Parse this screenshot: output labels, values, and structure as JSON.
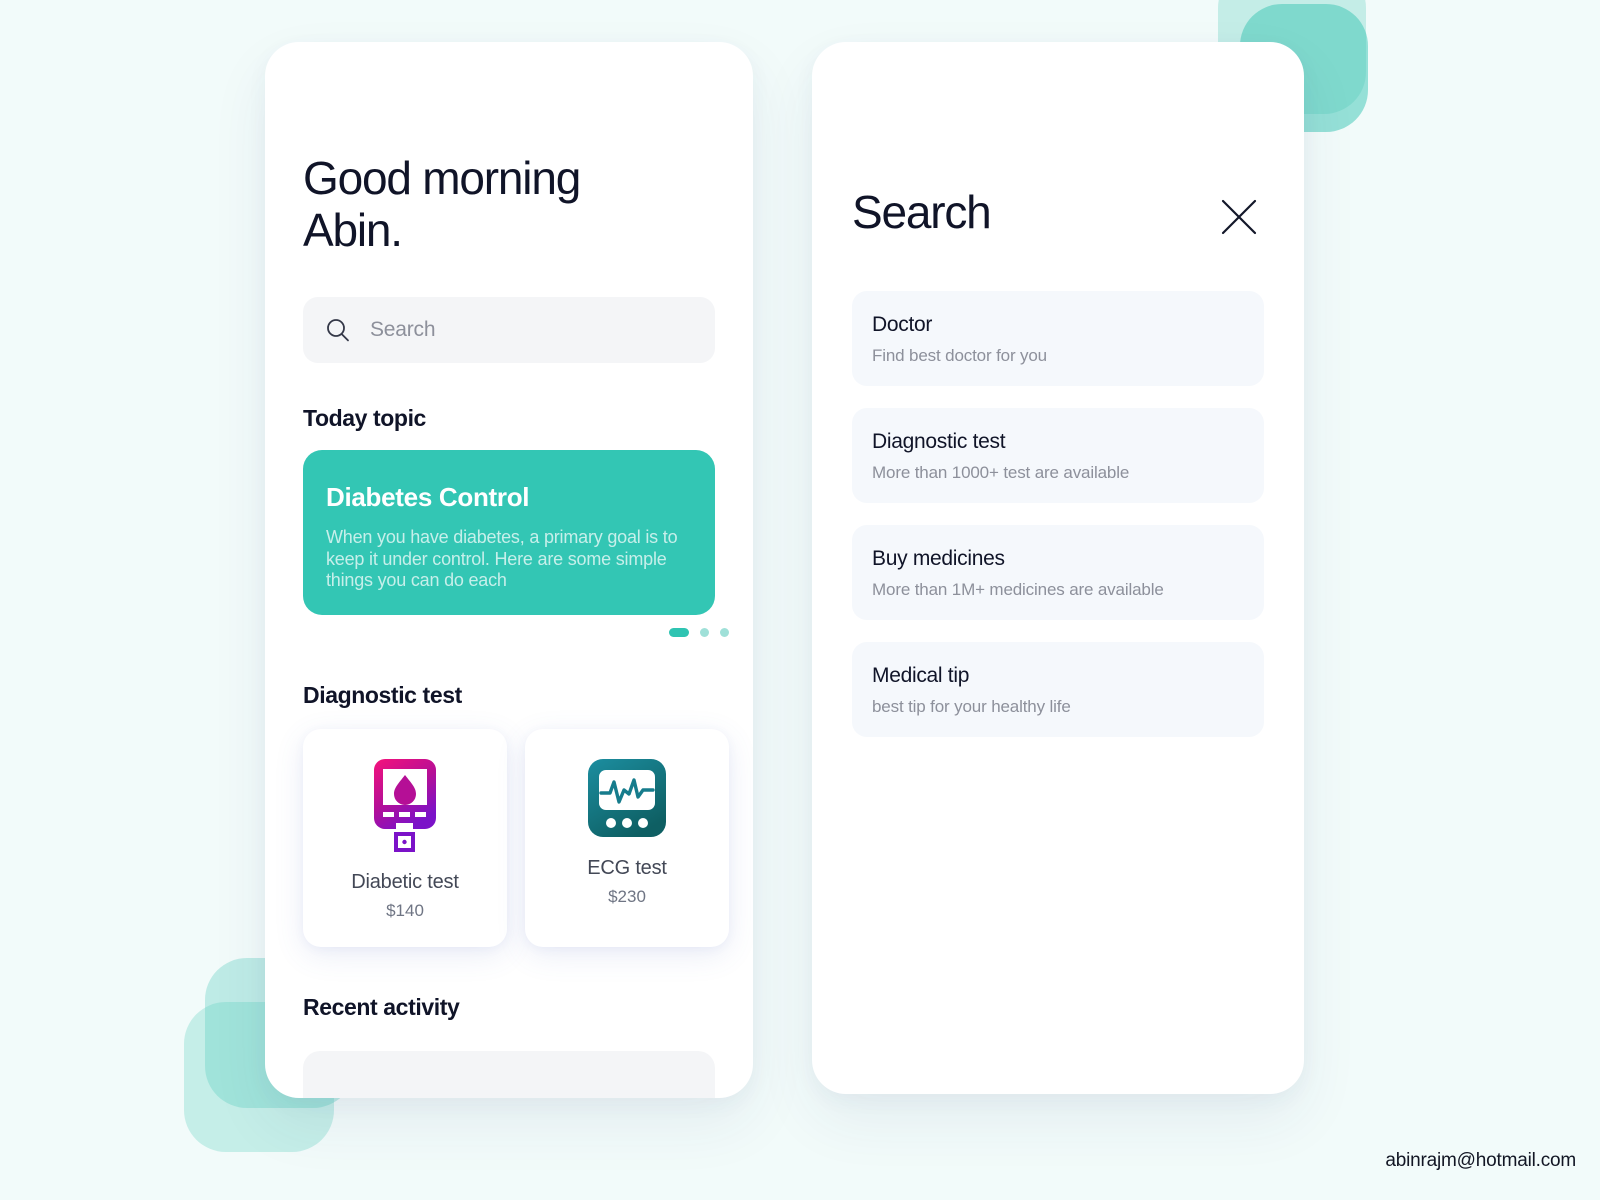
{
  "page": {
    "background_color": "#F2FBFA",
    "accent_color": "#33C6B4",
    "footer_email": "abinrajm@hotmail.com"
  },
  "home_screen": {
    "greeting_line1": "Good morning",
    "greeting_line2": "Abin.",
    "search": {
      "placeholder": "Search",
      "value": "",
      "icon": "search-icon"
    },
    "today_topic": {
      "section_title": "Today topic",
      "card": {
        "title": "Diabetes Control",
        "body": "When you have diabetes, a primary goal is to keep it under control. Here are some simple things you can do each",
        "background_color": "#33C6B4"
      },
      "pagination": {
        "total": 3,
        "active_index": 0
      }
    },
    "diagnostic_test": {
      "section_title": "Diagnostic test",
      "items": [
        {
          "name": "Diabetic test",
          "price": "$140",
          "icon": "glucometer-icon"
        },
        {
          "name": "ECG test",
          "price": "$230",
          "icon": "ecg-monitor-icon"
        }
      ]
    },
    "recent_activity": {
      "section_title": "Recent activity"
    }
  },
  "search_screen": {
    "title": "Search",
    "close_icon": "close-icon",
    "results": [
      {
        "title": "Doctor",
        "subtitle": "Find best doctor for you"
      },
      {
        "title": "Diagnostic test",
        "subtitle": "More than 1000+ test are available"
      },
      {
        "title": "Buy medicines",
        "subtitle": "More than 1M+ medicines are available"
      },
      {
        "title": "Medical tip",
        "subtitle": "best tip for your healthy life"
      }
    ]
  }
}
